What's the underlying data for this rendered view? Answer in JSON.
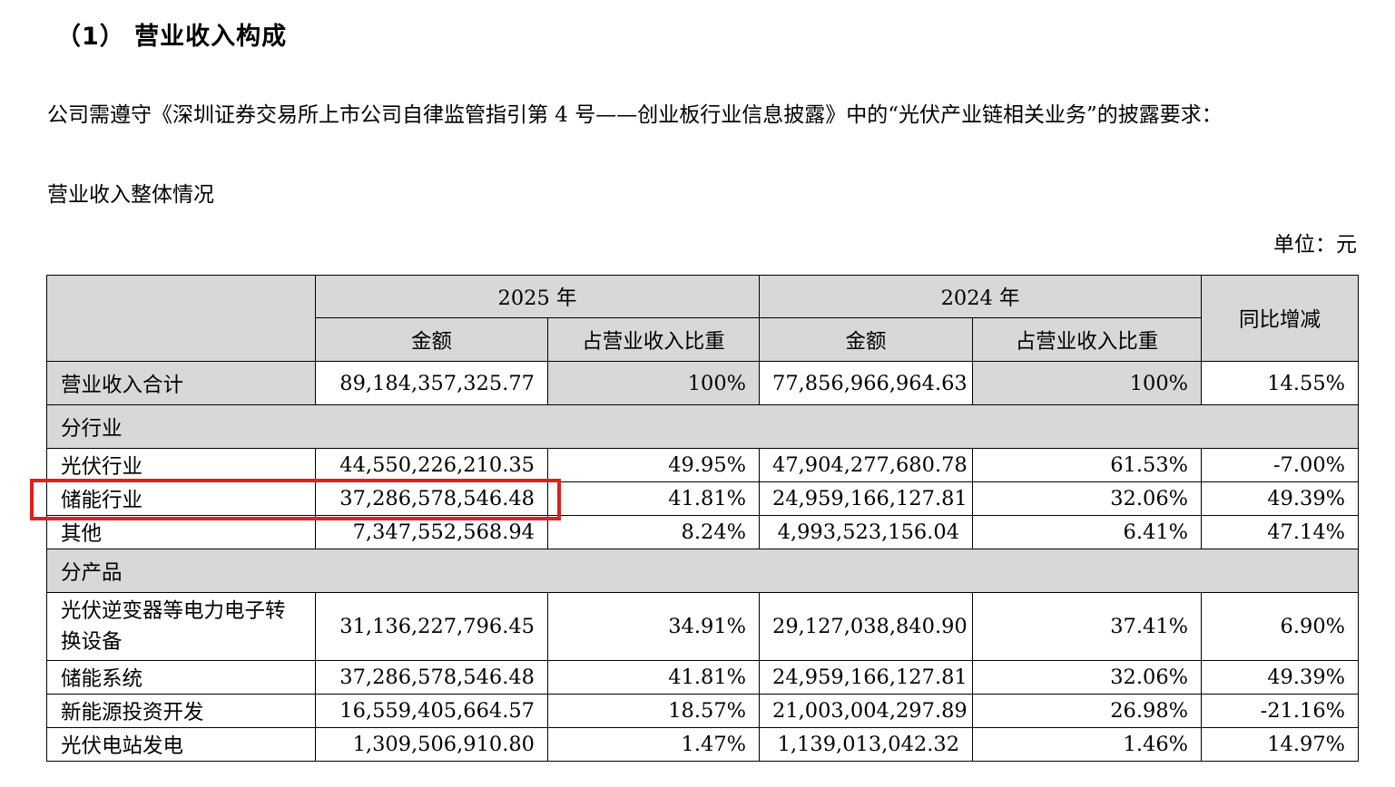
{
  "heading": "（1） 营业收入构成",
  "intro": "公司需遵守《深圳证券交易所上市公司自律监管指引第 4 号——创业板行业信息披露》中的“光伏产业链相关业务”的披露要求：",
  "subheading": "营业收入整体情况",
  "unit_label": "单位：元",
  "header": {
    "year_2025": "2025 年",
    "year_2024": "2024 年",
    "yoy": "同比增减",
    "amount": "金额",
    "share": "占营业收入比重"
  },
  "total": {
    "label": "营业收入合计",
    "a2025": "89,184,357,325.77",
    "s2025": "100%",
    "a2024": "77,856,966,964.63",
    "s2024": "100%",
    "yoy": "14.55%"
  },
  "group_industry": "分行业",
  "industry": [
    {
      "label": "光伏行业",
      "a2025": "44,550,226,210.35",
      "s2025": "49.95%",
      "a2024": "47,904,277,680.78",
      "s2024": "61.53%",
      "yoy": "-7.00%"
    },
    {
      "label": "储能行业",
      "a2025": "37,286,578,546.48",
      "s2025": "41.81%",
      "a2024": "24,959,166,127.81",
      "s2024": "32.06%",
      "yoy": "49.39%"
    },
    {
      "label": "其他",
      "a2025": "7,347,552,568.94",
      "s2025": "8.24%",
      "a2024": "4,993,523,156.04",
      "s2024": "6.41%",
      "yoy": "47.14%"
    }
  ],
  "group_product": "分产品",
  "product": [
    {
      "label": "光伏逆变器等电力电子转换设备",
      "a2025": "31,136,227,796.45",
      "s2025": "34.91%",
      "a2024": "29,127,038,840.90",
      "s2024": "37.41%",
      "yoy": "6.90%"
    },
    {
      "label": "储能系统",
      "a2025": "37,286,578,546.48",
      "s2025": "41.81%",
      "a2024": "24,959,166,127.81",
      "s2024": "32.06%",
      "yoy": "49.39%"
    },
    {
      "label": "新能源投资开发",
      "a2025": "16,559,405,664.57",
      "s2025": "18.57%",
      "a2024": "21,003,004,297.89",
      "s2024": "26.98%",
      "yoy": "-21.16%"
    },
    {
      "label": "光伏电站发电",
      "a2025": "1,309,506,910.80",
      "s2025": "1.47%",
      "a2024": "1,139,013,042.32",
      "s2024": "1.46%",
      "yoy": "14.97%"
    }
  ],
  "colors": {
    "header_bg": "#d8d8d8",
    "highlight_border": "#e02020"
  }
}
